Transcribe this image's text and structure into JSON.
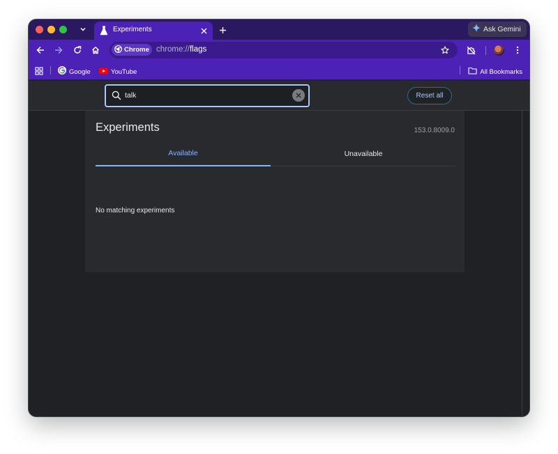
{
  "tab": {
    "title": "Experiments"
  },
  "gemini": {
    "label": "Ask Gemini"
  },
  "omnibox": {
    "chip_label": "Chrome",
    "url_scheme": "chrome://",
    "url_host": "flags"
  },
  "bookmarks": {
    "items": [
      {
        "label": "Google"
      },
      {
        "label": "YouTube"
      }
    ],
    "all_label": "All Bookmarks"
  },
  "flags": {
    "search_value": "talk",
    "reset_label": "Reset all",
    "title": "Experiments",
    "version": "153.0.8009.0",
    "tabs": [
      {
        "label": "Available",
        "active": true
      },
      {
        "label": "Unavailable",
        "active": false
      }
    ],
    "empty_message": "No matching experiments"
  },
  "colors": {
    "tab_strip": "#2a1861",
    "toolbar": "#4c22b6",
    "page_bg": "#202124",
    "card_bg": "#292a2d",
    "accent": "#8ab4f8"
  },
  "icons": [
    "tab-search-icon",
    "flask-icon",
    "close-icon",
    "plus-icon",
    "sparkle-icon",
    "back-arrow-icon",
    "forward-arrow-icon",
    "reload-icon",
    "home-icon",
    "chrome-icon",
    "star-icon",
    "extensions-icon",
    "kebab-menu-icon",
    "apps-grid-icon",
    "google-icon",
    "youtube-icon",
    "folder-icon",
    "search-icon",
    "clear-icon"
  ]
}
